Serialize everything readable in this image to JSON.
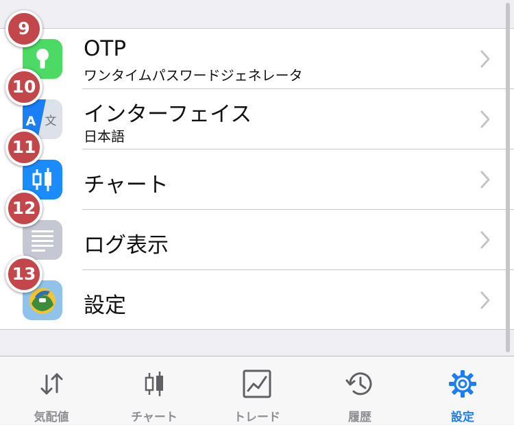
{
  "settings": {
    "items": [
      {
        "badge": "9",
        "title": "OTP",
        "subtitle": "ワンタイムパスワードジェネレータ",
        "icon": "key-icon",
        "icon_color": "#4cd964"
      },
      {
        "badge": "10",
        "title": "インターフェイス",
        "subtitle": "日本語",
        "icon": "translate-icon",
        "icon_color": "#1a7ef5"
      },
      {
        "badge": "11",
        "title": "チャート",
        "subtitle": "",
        "icon": "candlestick-icon",
        "icon_color": "#1a8cff"
      },
      {
        "badge": "12",
        "title": "ログ表示",
        "subtitle": "",
        "icon": "log-icon",
        "icon_color": "#c5c8d3"
      },
      {
        "badge": "13",
        "title": "設定",
        "subtitle": "",
        "icon": "metatrader-icon",
        "icon_color": "#8fc3ec"
      }
    ]
  },
  "tabbar": {
    "tabs": [
      {
        "label": "気配値",
        "icon": "quotes-arrows-icon",
        "active": false
      },
      {
        "label": "チャート",
        "icon": "chart-candles-icon",
        "active": false
      },
      {
        "label": "トレード",
        "icon": "trade-chart-icon",
        "active": false
      },
      {
        "label": "履歴",
        "icon": "history-clock-icon",
        "active": false
      },
      {
        "label": "設定",
        "icon": "settings-gear-icon",
        "active": true
      }
    ],
    "active_color": "#1a7ef5",
    "inactive_color": "#8e8e93"
  },
  "colors": {
    "badge": "#c3464b",
    "background": "#efeff4"
  }
}
